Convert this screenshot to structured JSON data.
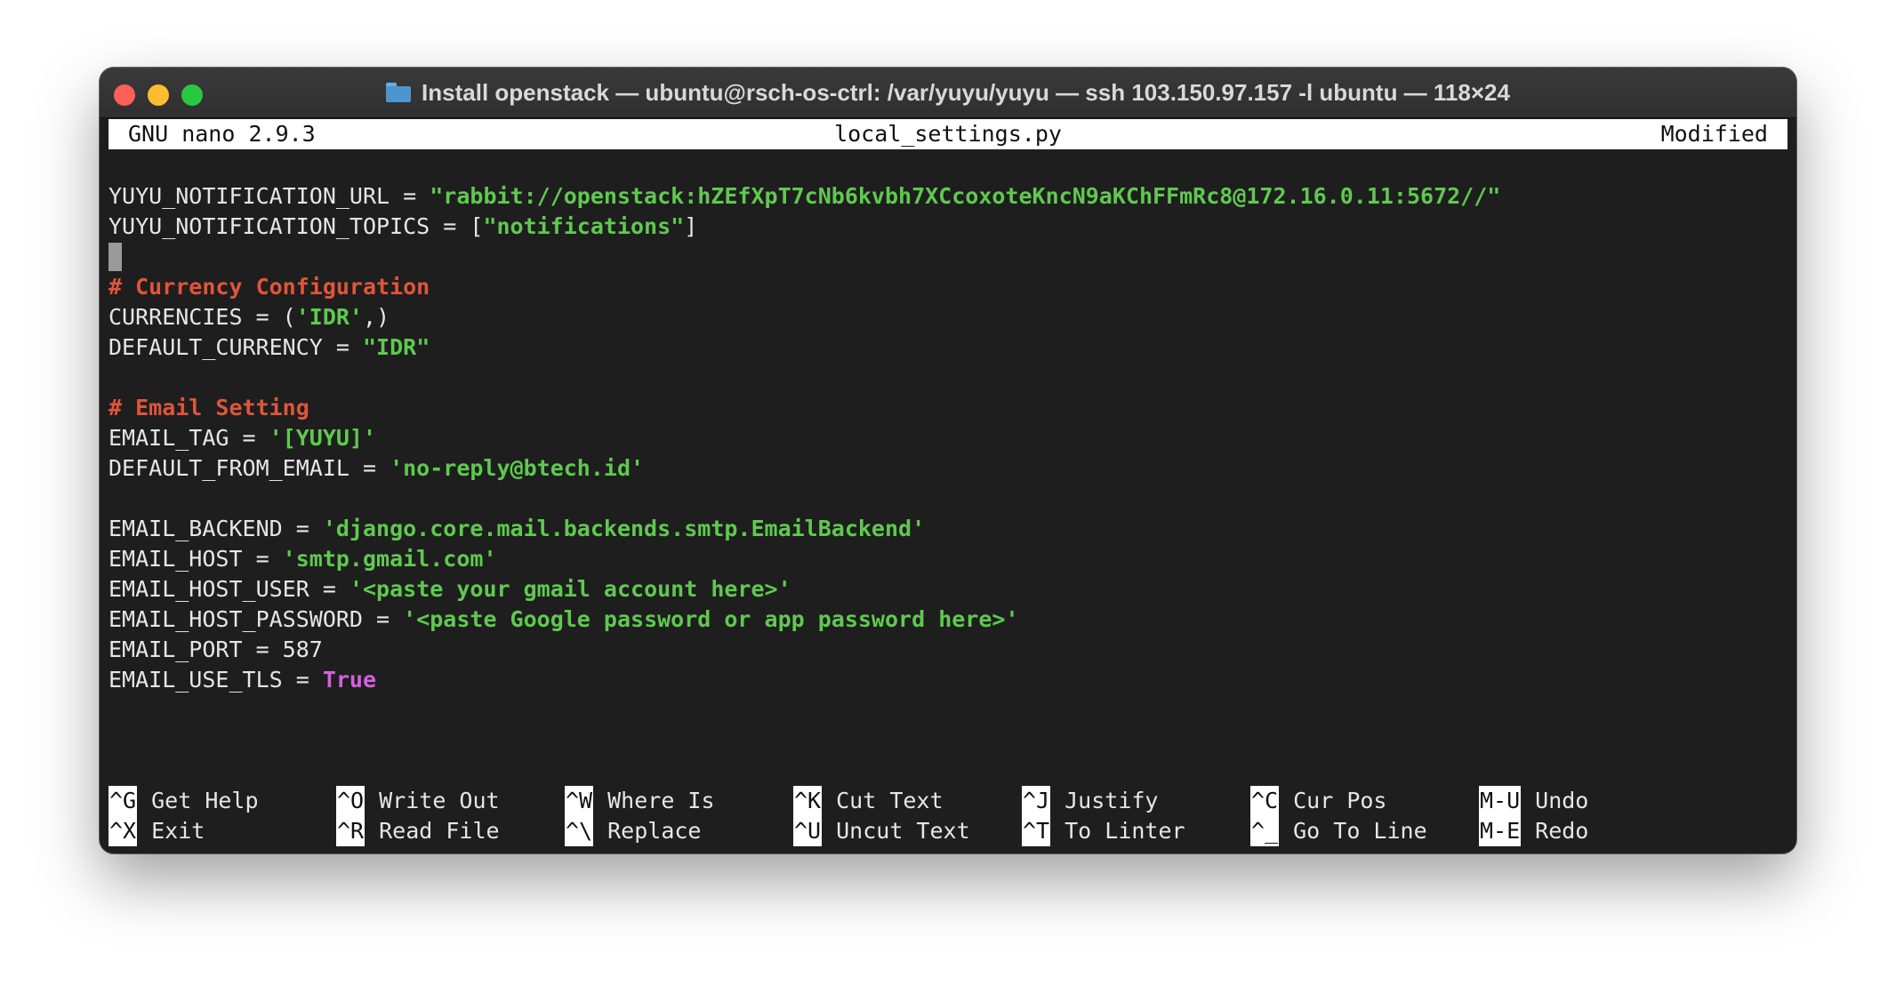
{
  "window": {
    "title": "Install openstack — ubuntu@rsch-os-ctrl: /var/yuyu/yuyu — ssh 103.150.97.157 -l ubuntu — 118×24"
  },
  "nano": {
    "version": "GNU nano 2.9.3",
    "filename": "local_settings.py",
    "state": "Modified"
  },
  "code": {
    "notification_url_key": "YUYU_NOTIFICATION_URL = ",
    "notification_url_value": "\"rabbit://openstack:hZEfXpT7cNb6kvbh7XCcoxoteKncN9aKChFFmRc8@172.16.0.11:5672//\"",
    "notification_topics_key": "YUYU_NOTIFICATION_TOPICS = [",
    "notification_topics_value": "\"notifications\"",
    "notification_topics_end": "]",
    "comment_currency": "# Currency Configuration",
    "currencies_key": "CURRENCIES = (",
    "currencies_value": "'IDR'",
    "currencies_end": ",)",
    "default_currency_key": "DEFAULT_CURRENCY = ",
    "default_currency_value": "\"IDR\"",
    "comment_email": "# Email Setting",
    "email_tag_key": "EMAIL_TAG = ",
    "email_tag_value": "'[YUYU]'",
    "default_from_key": "DEFAULT_FROM_EMAIL = ",
    "default_from_value": "'no-reply@btech.id'",
    "email_backend_key": "EMAIL_BACKEND = ",
    "email_backend_value": "'django.core.mail.backends.smtp.EmailBackend'",
    "email_host_key": "EMAIL_HOST = ",
    "email_host_value": "'smtp.gmail.com'",
    "email_host_user_key": "EMAIL_HOST_USER = ",
    "email_host_user_value": "'<paste your gmail account here>'",
    "email_host_password_key": "EMAIL_HOST_PASSWORD = ",
    "email_host_password_value": "'<paste Google password or app password here>'",
    "email_port_line": "EMAIL_PORT = 587",
    "email_use_tls_key": "EMAIL_USE_TLS = ",
    "email_use_tls_value": "True"
  },
  "shortcuts": [
    {
      "key": "^G",
      "label": "Get Help"
    },
    {
      "key": "^X",
      "label": "Exit"
    },
    {
      "key": "^O",
      "label": "Write Out"
    },
    {
      "key": "^R",
      "label": "Read File"
    },
    {
      "key": "^W",
      "label": "Where Is"
    },
    {
      "key": "^\\",
      "label": "Replace"
    },
    {
      "key": "^K",
      "label": "Cut Text"
    },
    {
      "key": "^U",
      "label": "Uncut Text"
    },
    {
      "key": "^J",
      "label": "Justify"
    },
    {
      "key": "^T",
      "label": "To Linter"
    },
    {
      "key": "^C",
      "label": "Cur Pos"
    },
    {
      "key": "^_",
      "label": "Go To Line"
    },
    {
      "key": "M-U",
      "label": "Undo"
    },
    {
      "key": "M-E",
      "label": "Redo"
    }
  ],
  "colors": {
    "string": "#5fc94f",
    "comment": "#e0553a",
    "keyword": "#d55fde",
    "background": "#1e1e1e",
    "close": "#fe5f57",
    "minimize": "#febc2e",
    "zoom": "#28c840"
  }
}
